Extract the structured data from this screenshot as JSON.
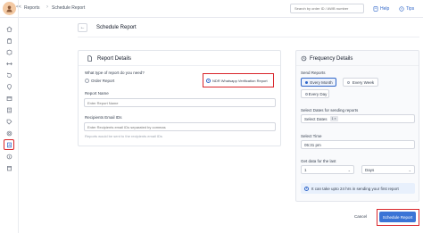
{
  "topbar": {
    "logo_initials": "",
    "breadcrumbs": [
      "Reports",
      "Schedule Report"
    ],
    "search_placeholder": "Search by order ID / AWB number",
    "help_label": "Help",
    "tips_label": "Tips"
  },
  "sidebar": {
    "items": [
      {
        "icon": "home-icon"
      },
      {
        "icon": "orders-icon"
      },
      {
        "icon": "box-icon"
      },
      {
        "icon": "shipping-icon"
      },
      {
        "icon": "returns-icon"
      },
      {
        "icon": "location-icon"
      },
      {
        "icon": "channels-icon"
      },
      {
        "icon": "billing-icon"
      },
      {
        "icon": "tag-icon"
      },
      {
        "icon": "support-icon"
      },
      {
        "icon": "reports-icon",
        "active": true
      },
      {
        "icon": "info-icon"
      },
      {
        "icon": "calendar-icon"
      }
    ]
  },
  "page": {
    "back_label": "←",
    "title": "Schedule Report"
  },
  "report_details": {
    "title": "Report Details",
    "question": "What type of report do you need?",
    "options": [
      "Order Report",
      "NDR Whatsapp Verification Report"
    ],
    "selected_option": "NDR Whatsapp Verification Report",
    "report_name_label": "Report Name",
    "report_name_placeholder": "Enter Report Name",
    "recipients_label": "Recipients Email IDs",
    "recipients_placeholder": "Enter Recipients email IDs separated by commas",
    "recipients_hint": "Reports would be sent to the recipients email IDs"
  },
  "frequency_details": {
    "title": "Frequency Details",
    "send_reports_label": "Send Reports",
    "frequency_options": [
      "Every Month",
      "Every Week",
      "Every Day"
    ],
    "selected_frequency": "Every Month",
    "select_dates_label": "Select Dates for sending reports",
    "select_dates_value": "Select Dates",
    "selected_date_chip": "1 ×",
    "select_time_label": "Select Time",
    "select_time_value": "05:31 pm",
    "last_label": "Get data for the last",
    "last_number": "1",
    "last_unit": "Days",
    "info_text": "It can take upto 24 hrs in sending your first report"
  },
  "footer": {
    "cancel_label": "Cancel",
    "submit_label": "Schedule Report"
  },
  "colors": {
    "accent": "#3b74d6",
    "highlight": "#d9242a"
  }
}
